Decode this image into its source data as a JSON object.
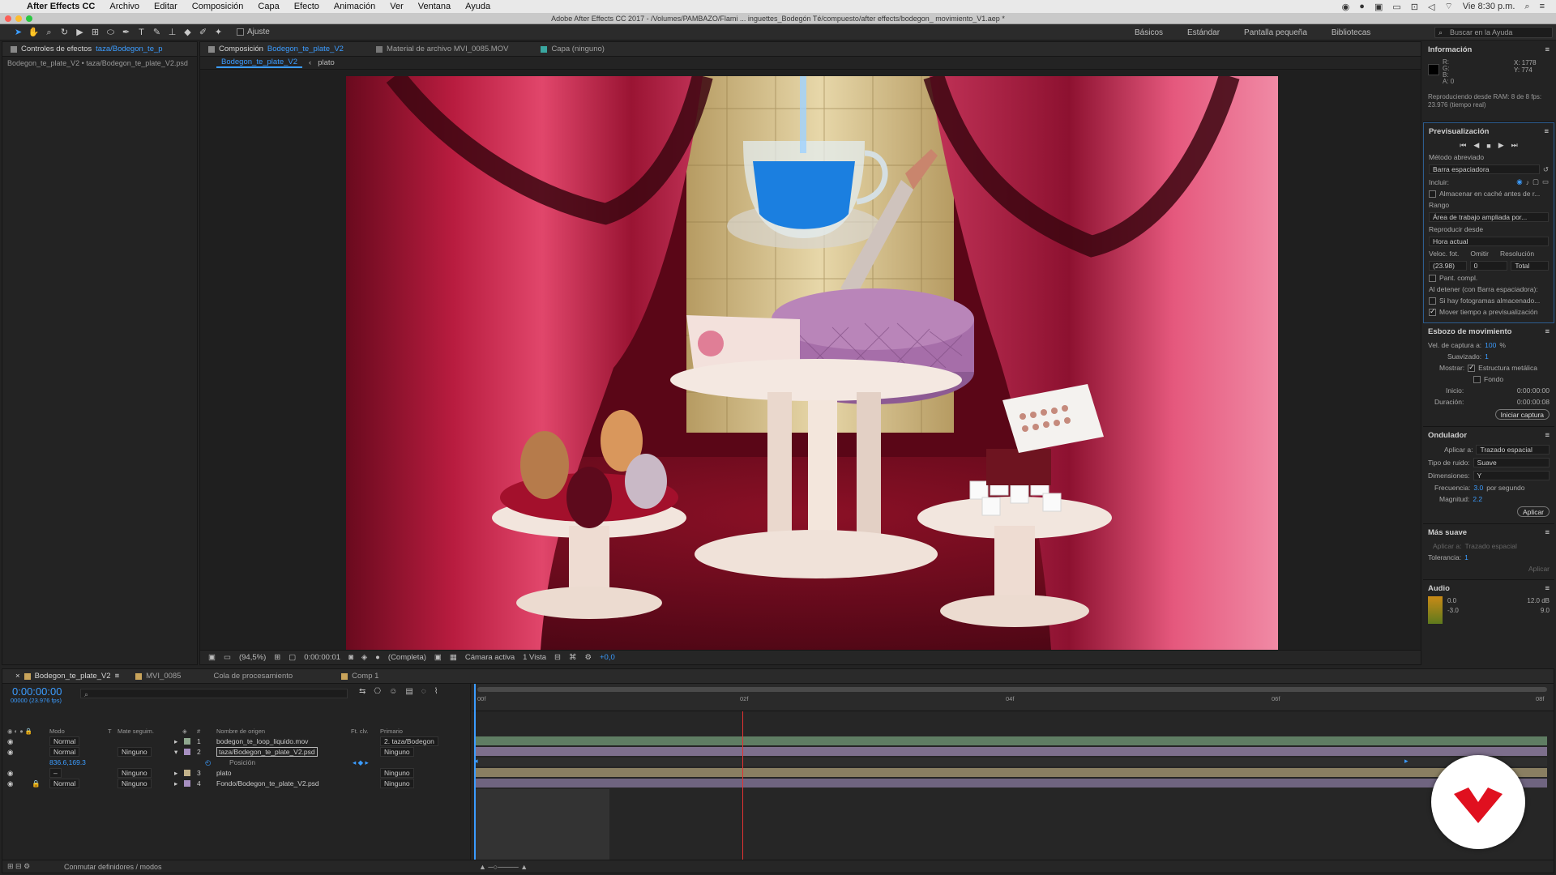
{
  "menubar": {
    "app": "After Effects CC",
    "items": [
      "Archivo",
      "Editar",
      "Composición",
      "Capa",
      "Efecto",
      "Animación",
      "Ver",
      "Ventana",
      "Ayuda"
    ],
    "clock": "Vie 8:30 p.m."
  },
  "window_title": "Adobe After Effects CC 2017 - /Volumes/PAMBAZO/Flami ... inguettes_Bodegón Té/compuesto/after effects/bodegon_ movimiento_V1.aep *",
  "toolbar": {
    "snap_label": "Ajuste",
    "workspaces": [
      "Básicos",
      "Estándar",
      "Pantalla pequeña",
      "Bibliotecas"
    ],
    "search_placeholder": "Buscar en la Ayuda"
  },
  "effects_panel": {
    "tab_label": "Controles de efectos",
    "tab_target": "taza/Bodegon_te_p",
    "subtitle": "Bodegon_te_plate_V2 • taza/Bodegon_te_plate_V2.psd"
  },
  "comp_panel": {
    "tabs": [
      {
        "label": "Composición",
        "target": "Bodegon_te_plate_V2"
      },
      {
        "label": "Material de archivo MVI_0085.MOV",
        "target": ""
      },
      {
        "label": "Capa (ninguno)",
        "target": ""
      }
    ],
    "crumbs": [
      "Bodegon_te_plate_V2",
      "plato"
    ],
    "bottom": {
      "zoom": "(94,5%)",
      "timecode": "0:00:00:01",
      "quality": "(Completa)",
      "camera": "Cámara activa",
      "views": "1 Vista",
      "exposure": "+0,0"
    }
  },
  "info_panel": {
    "title": "Información",
    "r": "R:",
    "g": "G:",
    "b": "B:",
    "a": "A: 0",
    "x": "X: 1778",
    "y": "Y: 774",
    "status": "Reproduciendo desde RAM: 8 de 8 fps: 23.976 (tiempo real)"
  },
  "preview_panel": {
    "title": "Previsualización",
    "shortcut_label": "Método abreviado",
    "shortcut_value": "Barra espaciadora",
    "include_label": "Incluir:",
    "cache_label": "Almacenar en caché antes de r...",
    "range_label": "Rango",
    "range_value": "Área de trabajo ampliada por...",
    "play_from_label": "Reproducir desde",
    "play_from_value": "Hora actual",
    "fps_label": "Veloc. fot.",
    "skip_label": "Omitir",
    "res_label": "Resolución",
    "fps_value": "(23.98)",
    "skip_value": "0",
    "res_value": "Total",
    "fullscreen_label": "Pant. compl.",
    "on_stop_label": "Al detener (con Barra espaciadora):",
    "if_cached_label": "Si hay fotogramas almacenado...",
    "move_time_label": "Mover tiempo a previsualización"
  },
  "motion_sketch": {
    "title": "Esbozo de movimiento",
    "capture_label": "Vel. de captura a:",
    "capture_value": "100",
    "capture_unit": "%",
    "smooth_label": "Suavizado:",
    "smooth_value": "1",
    "show_label": "Mostrar:",
    "wireframe_label": "Estructura metálica",
    "bg_label": "Fondo",
    "start_label": "Inicio:",
    "start_value": "0:00:00:00",
    "duration_label": "Duración:",
    "duration_value": "0:00:00:08",
    "button": "Iniciar captura"
  },
  "wiggler": {
    "title": "Ondulador",
    "apply_to_label": "Aplicar a:",
    "apply_to_value": "Trazado espacial",
    "noise_label": "Tipo de ruido:",
    "noise_value": "Suave",
    "dims_label": "Dimensiones:",
    "dims_value": "Y",
    "freq_label": "Frecuencia:",
    "freq_value": "3.0",
    "freq_unit": "por segundo",
    "mag_label": "Magnitud:",
    "mag_value": "2.2",
    "button": "Aplicar"
  },
  "smoother": {
    "title": "Más suave",
    "apply_to_label": "Aplicar a:",
    "apply_to_value": "Trazado espacial",
    "tol_label": "Tolerancia:",
    "tol_value": "1",
    "button": "Aplicar"
  },
  "audio": {
    "title": "Audio",
    "levels": [
      "0.0",
      "-3.0"
    ],
    "db": [
      "12.0 dB",
      "9.0"
    ]
  },
  "timeline": {
    "tabs": [
      "Bodegon_te_plate_V2",
      "MVI_0085",
      "Cola de procesamiento",
      "Comp 1"
    ],
    "timecode": "0:00:00:00",
    "fps": "00000 (23.976 fps)",
    "col_mode": "Modo",
    "col_t": "T",
    "col_matte": "Mate seguim.",
    "col_num": "#",
    "col_name": "Nombre de origen",
    "col_fx": "Ft. clv.",
    "col_parent": "Primario",
    "ruler": [
      "00f",
      "02f",
      "04f",
      "06f",
      "08f"
    ],
    "layers": [
      {
        "num": "1",
        "mode": "Normal",
        "matte": "",
        "name": "bodegon_te_loop_liquido.mov",
        "parent": "2. taza/Bodegon"
      },
      {
        "num": "2",
        "mode": "Normal",
        "matte": "Ninguno",
        "name": "taza/Bodegon_te_plate_V2.psd",
        "parent": "Ninguno"
      },
      {
        "num": "",
        "mode": "",
        "matte": "",
        "name": "Posición",
        "parent": "",
        "value": "836.6,169.3"
      },
      {
        "num": "3",
        "mode": "–",
        "matte": "Ninguno",
        "name": "plato",
        "parent": "Ninguno"
      },
      {
        "num": "4",
        "mode": "Normal",
        "matte": "Ninguno",
        "name": "Fondo/Bodegon_te_plate_V2.psd",
        "parent": "Ninguno"
      }
    ],
    "footer": "Conmutar definidores / modos"
  },
  "colors": {
    "accent": "#3b9cff",
    "playhead": "#e23232",
    "bar_green": "#5f7d63",
    "bar_purple": "#7d6f8c",
    "bar_tan": "#8a7f62"
  }
}
